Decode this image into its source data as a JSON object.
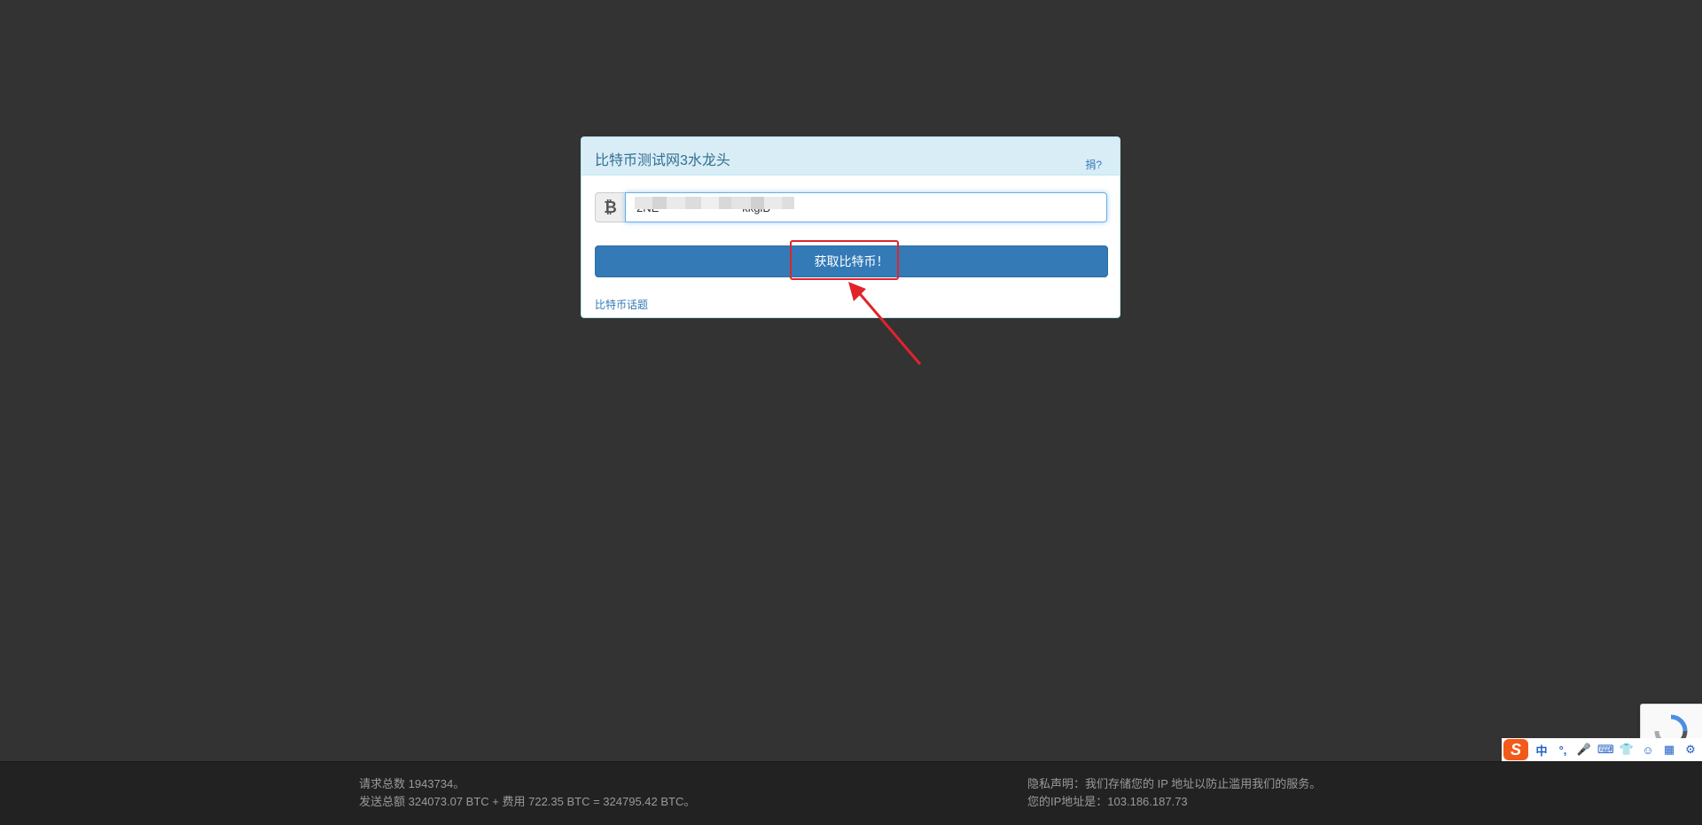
{
  "panel": {
    "title": "比特币测试网3水龙头",
    "donate_label": "捐?",
    "address_icon": "₿",
    "address_value": "2NE                          kkgiB",
    "submit_label": "获取比特币！",
    "topic_link": "比特币话题"
  },
  "footer": {
    "left_line1": "请求总数 1943734。",
    "left_line2": "发送总额 324073.07 BTC + 费用 722.35 BTC = 324795.42 BTC。",
    "right_line1": "隐私声明：我们存储您的 IP 地址以防止滥用我们的服务。",
    "right_line2": "您的IP地址是：103.186.187.73"
  },
  "ime": {
    "logo": "S",
    "items": [
      "中",
      "°,",
      "🎤",
      "⌨",
      "👕",
      "☺",
      "▦",
      "⚙"
    ]
  },
  "colors": {
    "background": "#333333",
    "panel_heading": "#d9edf7",
    "button": "#337ab7",
    "highlight": "#e0242a"
  }
}
